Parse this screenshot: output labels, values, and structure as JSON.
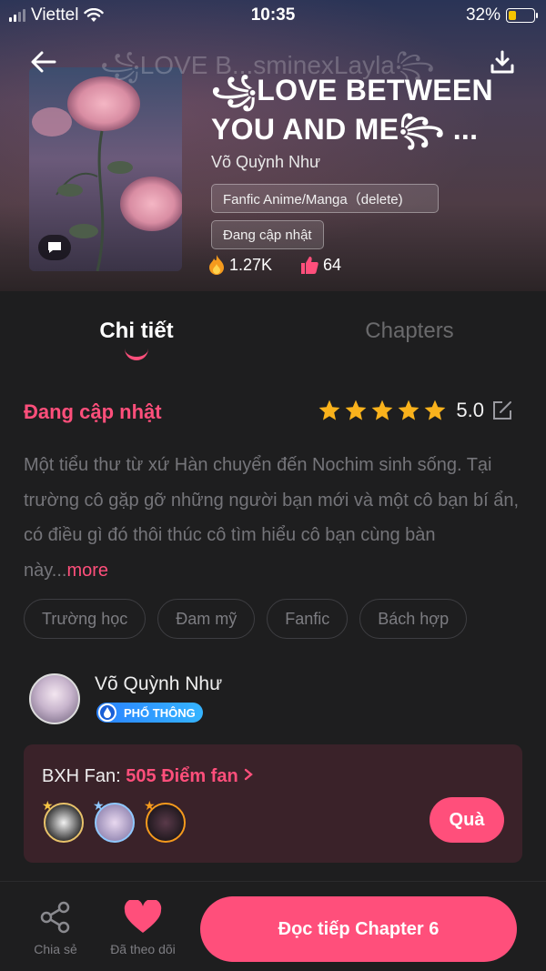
{
  "status_bar": {
    "carrier": "Viettel",
    "time": "10:35",
    "battery": "32%",
    "battery_level": 0.32
  },
  "header": {
    "ghost_title": "꧁LOVE B...sminexLayla꧂"
  },
  "book": {
    "title": "꧁LOVE BETWEEN YOU AND ME꧂ ...",
    "author": "Võ Quỳnh Như",
    "genre": "Fanfic Anime/Manga（delete)",
    "update_status": "Đang cập nhật",
    "views": "1.27K",
    "likes": "64"
  },
  "tabs": [
    {
      "label": "Chi tiết",
      "active": true
    },
    {
      "label": "Chapters",
      "active": false
    }
  ],
  "details": {
    "status": "Đang cập nhật",
    "stars": 5,
    "rating": "5.0",
    "description": "Một tiểu thư từ xứ Hàn chuyển đến Nochim sinh sống. Tại trường cô gặp gỡ những người bạn mới và một cô bạn bí ẩn, có điều gì đó thôi thúc cô tìm hiểu cô bạn cùng bàn này...",
    "more_label": "more",
    "tags": [
      "Trường học",
      "Đam mỹ",
      "Fanfic",
      "Bách hợp"
    ]
  },
  "author_card": {
    "name": "Võ Quỳnh Như",
    "rank": "PHỔ THÔNG"
  },
  "fan_board": {
    "label": "BXH Fan: ",
    "points": "505 Điểm fan",
    "gift_label": "Quà"
  },
  "bottom_bar": {
    "share_label": "Chia sẻ",
    "follow_label": "Đã theo dõi",
    "read_label": "Đọc tiếp Chapter 6"
  },
  "colors": {
    "accent": "#ff4f7b",
    "background": "#1e1e1f"
  }
}
